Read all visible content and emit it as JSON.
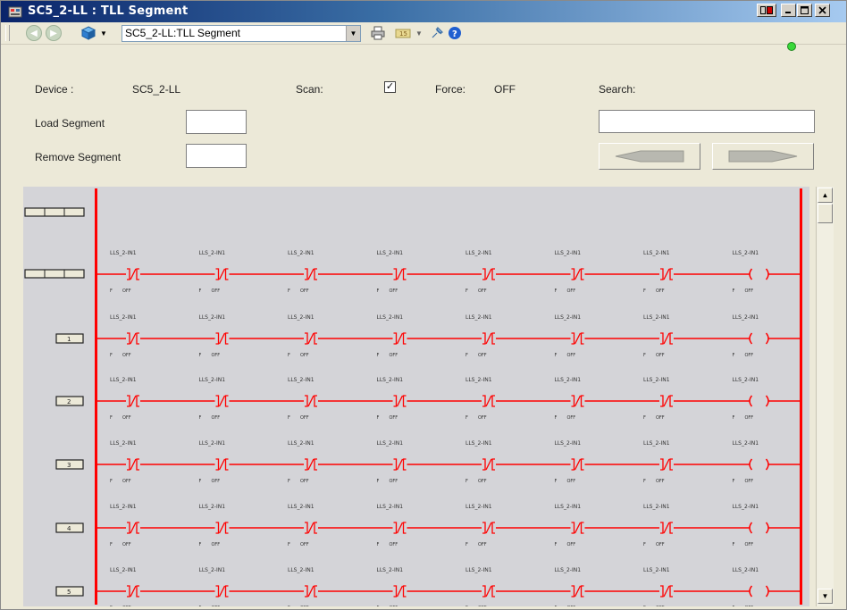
{
  "window": {
    "title": "SC5_2-LL : TLL Segment",
    "controls": [
      "minimize",
      "maximize",
      "close"
    ]
  },
  "toolbar": {
    "location": "SC5_2-LL:TLL Segment"
  },
  "status": {
    "device_label": "Device :",
    "device_value": "SC5_2-LL",
    "scan_label": "Scan:",
    "scan_checked": "☑",
    "force_label": "Force:",
    "force_value": "OFF",
    "search_label": "Search:",
    "led_color": "#3ad83a"
  },
  "segment": {
    "load_label": "Load Segment",
    "remove_label": "Remove Segment"
  },
  "ladder": {
    "rail_color": "#ff0000",
    "contact_tag": "LLS_2-IN1",
    "contact_state": "F",
    "contact_value": "OFF",
    "contacts_per_rung": 7,
    "rung_labels": [
      "1",
      "2",
      "3",
      "4",
      "5",
      "6"
    ]
  }
}
